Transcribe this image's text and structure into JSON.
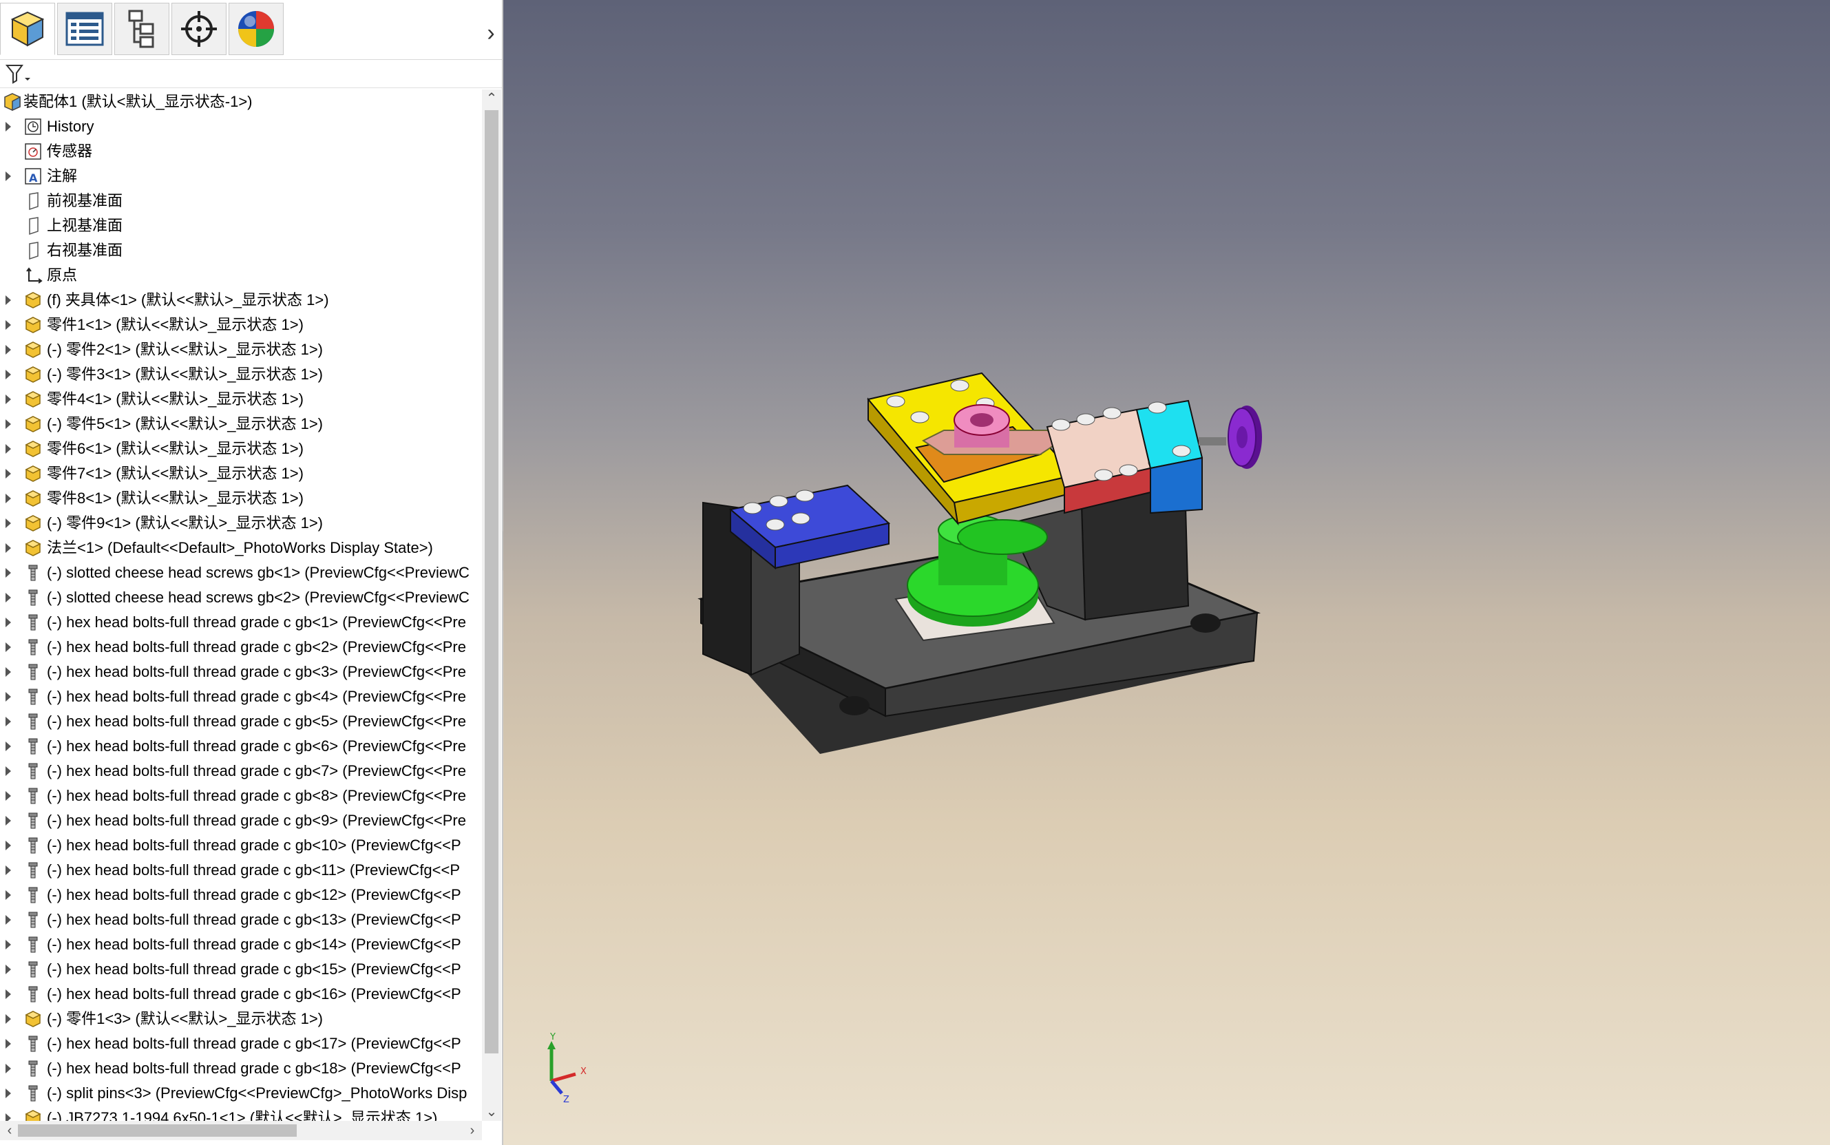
{
  "feature_tree": {
    "root": "装配体1  (默认<默认_显示状态-1>)",
    "items": [
      {
        "label": "History",
        "icon": "history-icon",
        "expandable": true
      },
      {
        "label": "传感器",
        "icon": "sensor-icon",
        "expandable": false
      },
      {
        "label": "注解",
        "icon": "annotation-icon",
        "expandable": true
      },
      {
        "label": "前视基准面",
        "icon": "plane-icon",
        "expandable": false
      },
      {
        "label": "上视基准面",
        "icon": "plane-icon",
        "expandable": false
      },
      {
        "label": "右视基准面",
        "icon": "plane-icon",
        "expandable": false
      },
      {
        "label": "原点",
        "icon": "origin-icon",
        "expandable": false
      },
      {
        "label": "(f) 夹具体<1> (默认<<默认>_显示状态 1>)",
        "icon": "part-icon",
        "expandable": true
      },
      {
        "label": "零件1<1> (默认<<默认>_显示状态 1>)",
        "icon": "part-icon",
        "expandable": true
      },
      {
        "label": "(-) 零件2<1> (默认<<默认>_显示状态 1>)",
        "icon": "part-icon",
        "expandable": true
      },
      {
        "label": "(-) 零件3<1> (默认<<默认>_显示状态 1>)",
        "icon": "part-icon",
        "expandable": true
      },
      {
        "label": "零件4<1> (默认<<默认>_显示状态 1>)",
        "icon": "part-icon",
        "expandable": true
      },
      {
        "label": "(-) 零件5<1> (默认<<默认>_显示状态 1>)",
        "icon": "part-icon",
        "expandable": true
      },
      {
        "label": "零件6<1> (默认<<默认>_显示状态 1>)",
        "icon": "part-icon",
        "expandable": true
      },
      {
        "label": "零件7<1> (默认<<默认>_显示状态 1>)",
        "icon": "part-icon",
        "expandable": true
      },
      {
        "label": "零件8<1> (默认<<默认>_显示状态 1>)",
        "icon": "part-icon",
        "expandable": true
      },
      {
        "label": "(-) 零件9<1> (默认<<默认>_显示状态 1>)",
        "icon": "part-icon",
        "expandable": true
      },
      {
        "label": "法兰<1> (Default<<Default>_PhotoWorks Display State>)",
        "icon": "part-icon",
        "expandable": true
      },
      {
        "label": "(-) slotted cheese head screws gb<1> (PreviewCfg<<PreviewC",
        "icon": "screw-icon",
        "expandable": true
      },
      {
        "label": "(-) slotted cheese head screws gb<2> (PreviewCfg<<PreviewC",
        "icon": "screw-icon",
        "expandable": true
      },
      {
        "label": "(-) hex head bolts-full thread grade c gb<1> (PreviewCfg<<Pre",
        "icon": "screw-icon",
        "expandable": true
      },
      {
        "label": "(-) hex head bolts-full thread grade c gb<2> (PreviewCfg<<Pre",
        "icon": "screw-icon",
        "expandable": true
      },
      {
        "label": "(-) hex head bolts-full thread grade c gb<3> (PreviewCfg<<Pre",
        "icon": "screw-icon",
        "expandable": true
      },
      {
        "label": "(-) hex head bolts-full thread grade c gb<4> (PreviewCfg<<Pre",
        "icon": "screw-icon",
        "expandable": true
      },
      {
        "label": "(-) hex head bolts-full thread grade c gb<5> (PreviewCfg<<Pre",
        "icon": "screw-icon",
        "expandable": true
      },
      {
        "label": "(-) hex head bolts-full thread grade c gb<6> (PreviewCfg<<Pre",
        "icon": "screw-icon",
        "expandable": true
      },
      {
        "label": "(-) hex head bolts-full thread grade c gb<7> (PreviewCfg<<Pre",
        "icon": "screw-icon",
        "expandable": true
      },
      {
        "label": "(-) hex head bolts-full thread grade c gb<8> (PreviewCfg<<Pre",
        "icon": "screw-icon",
        "expandable": true
      },
      {
        "label": "(-) hex head bolts-full thread grade c gb<9> (PreviewCfg<<Pre",
        "icon": "screw-icon",
        "expandable": true
      },
      {
        "label": "(-) hex head bolts-full thread grade c gb<10> (PreviewCfg<<P",
        "icon": "screw-icon",
        "expandable": true
      },
      {
        "label": "(-) hex head bolts-full thread grade c gb<11> (PreviewCfg<<P",
        "icon": "screw-icon",
        "expandable": true
      },
      {
        "label": "(-) hex head bolts-full thread grade c gb<12> (PreviewCfg<<P",
        "icon": "screw-icon",
        "expandable": true
      },
      {
        "label": "(-) hex head bolts-full thread grade c gb<13> (PreviewCfg<<P",
        "icon": "screw-icon",
        "expandable": true
      },
      {
        "label": "(-) hex head bolts-full thread grade c gb<14> (PreviewCfg<<P",
        "icon": "screw-icon",
        "expandable": true
      },
      {
        "label": "(-) hex head bolts-full thread grade c gb<15> (PreviewCfg<<P",
        "icon": "screw-icon",
        "expandable": true
      },
      {
        "label": "(-) hex head bolts-full thread grade c gb<16> (PreviewCfg<<P",
        "icon": "screw-icon",
        "expandable": true
      },
      {
        "label": "(-) 零件1<3> (默认<<默认>_显示状态 1>)",
        "icon": "part-icon",
        "expandable": true
      },
      {
        "label": "(-) hex head bolts-full thread grade c gb<17> (PreviewCfg<<P",
        "icon": "screw-icon",
        "expandable": true
      },
      {
        "label": "(-) hex head bolts-full thread grade c gb<18> (PreviewCfg<<P",
        "icon": "screw-icon",
        "expandable": true
      },
      {
        "label": "(-) split pins<3> (PreviewCfg<<PreviewCfg>_PhotoWorks Disp",
        "icon": "screw-icon",
        "expandable": true
      },
      {
        "label": "(-) JB7273.1-1994 6x50-1<1> (默认<<默认>_显示状态 1>)",
        "icon": "part-icon",
        "expandable": true
      }
    ]
  },
  "panel_tabs": [
    "feature-manager-tab",
    "property-manager-tab",
    "configuration-manager-tab",
    "dimxpert-tab",
    "display-manager-tab"
  ],
  "triad": {
    "x": "X",
    "y": "Y",
    "z": "Z"
  },
  "colors": {
    "yellow_plate": "#f5e600",
    "blue_plate": "#3b48d6",
    "green_flange": "#22cc22",
    "pink_part": "#e8c5b8",
    "red_block": "#c8393c",
    "cyan_block": "#1ee0f0",
    "purple_knob": "#7a1bb5",
    "base": "#2b2b2b"
  }
}
